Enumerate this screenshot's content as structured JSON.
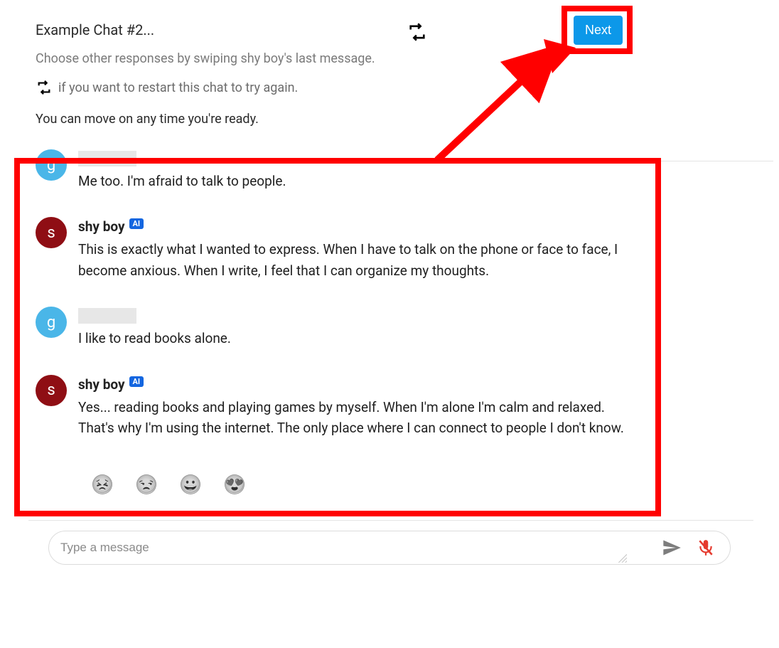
{
  "header": {
    "title": "Example Chat #2...",
    "next_label": "Next"
  },
  "instructions": {
    "line1": "Choose other responses by swiping shy boy's last message.",
    "line2": "if you want to restart this chat to try again.",
    "line3": "You can move on any time you're ready."
  },
  "bot": {
    "name": "shy boy",
    "ai_badge": "AI",
    "avatar_letter": "s"
  },
  "user": {
    "avatar_letter": "g"
  },
  "messages": [
    {
      "sender": "user",
      "text": "Me too. I'm afraid to talk to people."
    },
    {
      "sender": "bot",
      "text": "This is exactly what I wanted to express.  When I have to talk on the phone or face to face, I become anxious.  When I write, I feel that I can organize my thoughts."
    },
    {
      "sender": "user",
      "text": "I like to read books alone."
    },
    {
      "sender": "bot",
      "text": "Yes...  reading books and playing games by myself.  When I'm alone I'm calm and relaxed.  That's why I'm using the internet.  The only place where I can connect to people I don't know."
    }
  ],
  "reactions": [
    "😣",
    "😒",
    "😀",
    "😍"
  ],
  "input": {
    "placeholder": "Type a message"
  }
}
